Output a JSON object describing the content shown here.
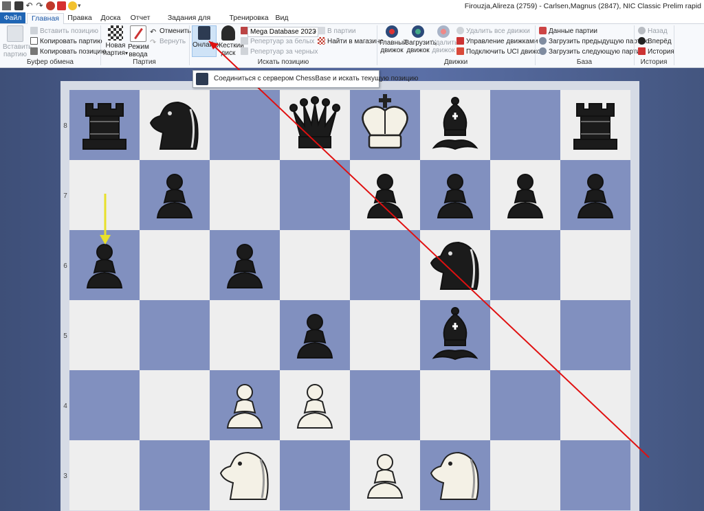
{
  "window": {
    "title": "Firouzja,Alireza (2759) - Carlsen,Magnus (2847), NIC Classic Prelim rapid"
  },
  "tabs": [
    {
      "label": "Файл"
    },
    {
      "label": "Главная"
    },
    {
      "label": "Правка"
    },
    {
      "label": "Доска"
    },
    {
      "label": "Отчет"
    },
    {
      "label": "Задания для анализа"
    },
    {
      "label": "Тренировка"
    },
    {
      "label": "Вид"
    }
  ],
  "ribbon": {
    "clipboard": {
      "paste_label": "Вставить партию",
      "paste_position": "Вставить позицию",
      "copy_game": "Копировать партию",
      "copy_position": "Копировать позицию",
      "group_label": "Буфер обмена"
    },
    "game": {
      "new_game": "Новая партия",
      "input_mode": "Режим ввода",
      "undo": "Отменить",
      "redo": "Вернуть",
      "group_label": "Партия"
    },
    "search": {
      "online": "Онлайн",
      "hard_disk": "Жесткий диск",
      "database": "Mega Database 2023",
      "rep_white": "Репертуар за белых",
      "rep_black": "Репертуар за черных",
      "in_games": "В партии",
      "find_shop": "Найти в магазине",
      "group_label": "Искать позицию"
    },
    "engines": {
      "main_engine": "Главный движок",
      "load_engine": "Загрузить движок",
      "remove_engine": "Удалить движок",
      "remove_all": "Удалить все движки",
      "manage": "Управление движками",
      "connect_uci": "Подключить UCI движок",
      "group_label": "Движки"
    },
    "base": {
      "game_data": "Данные партии",
      "load_prev": "Загрузить предыдущую партию",
      "load_next": "Загрузить следующую партию",
      "group_label": "База"
    },
    "history": {
      "back": "Назад",
      "forward": "Вперёд",
      "history": "История",
      "group_label": "История"
    }
  },
  "tooltip": {
    "text": "Соединиться с сервером ChessBase и искать текущую позицию"
  },
  "board": {
    "ranks": [
      "8",
      "7",
      "6",
      "5",
      "4",
      "3"
    ],
    "pieces": [
      {
        "square": "a8",
        "piece": "black-rook"
      },
      {
        "square": "b8",
        "piece": "black-knight"
      },
      {
        "square": "d8",
        "piece": "black-queen"
      },
      {
        "square": "e8",
        "piece": "white-king"
      },
      {
        "square": "f8",
        "piece": "black-bishop"
      },
      {
        "square": "h8",
        "piece": "black-rook"
      },
      {
        "square": "b7",
        "piece": "black-pawn"
      },
      {
        "square": "e7",
        "piece": "black-pawn"
      },
      {
        "square": "f7",
        "piece": "black-pawn"
      },
      {
        "square": "g7",
        "piece": "black-pawn"
      },
      {
        "square": "h7",
        "piece": "black-pawn"
      },
      {
        "square": "a6",
        "piece": "black-pawn"
      },
      {
        "square": "c6",
        "piece": "black-pawn"
      },
      {
        "square": "f6",
        "piece": "black-knight"
      },
      {
        "square": "d5",
        "piece": "black-pawn"
      },
      {
        "square": "f5",
        "piece": "black-bishop"
      },
      {
        "square": "c4",
        "piece": "white-pawn"
      },
      {
        "square": "d4",
        "piece": "white-pawn"
      },
      {
        "square": "c3",
        "piece": "white-knight"
      },
      {
        "square": "e3",
        "piece": "white-pawn"
      },
      {
        "square": "f3",
        "piece": "white-knight"
      }
    ],
    "colors": {
      "light": "#eeeeee",
      "dark": "#8190bf",
      "move_arrow": "#e8e02a",
      "annotation_line": "#e01010"
    }
  }
}
